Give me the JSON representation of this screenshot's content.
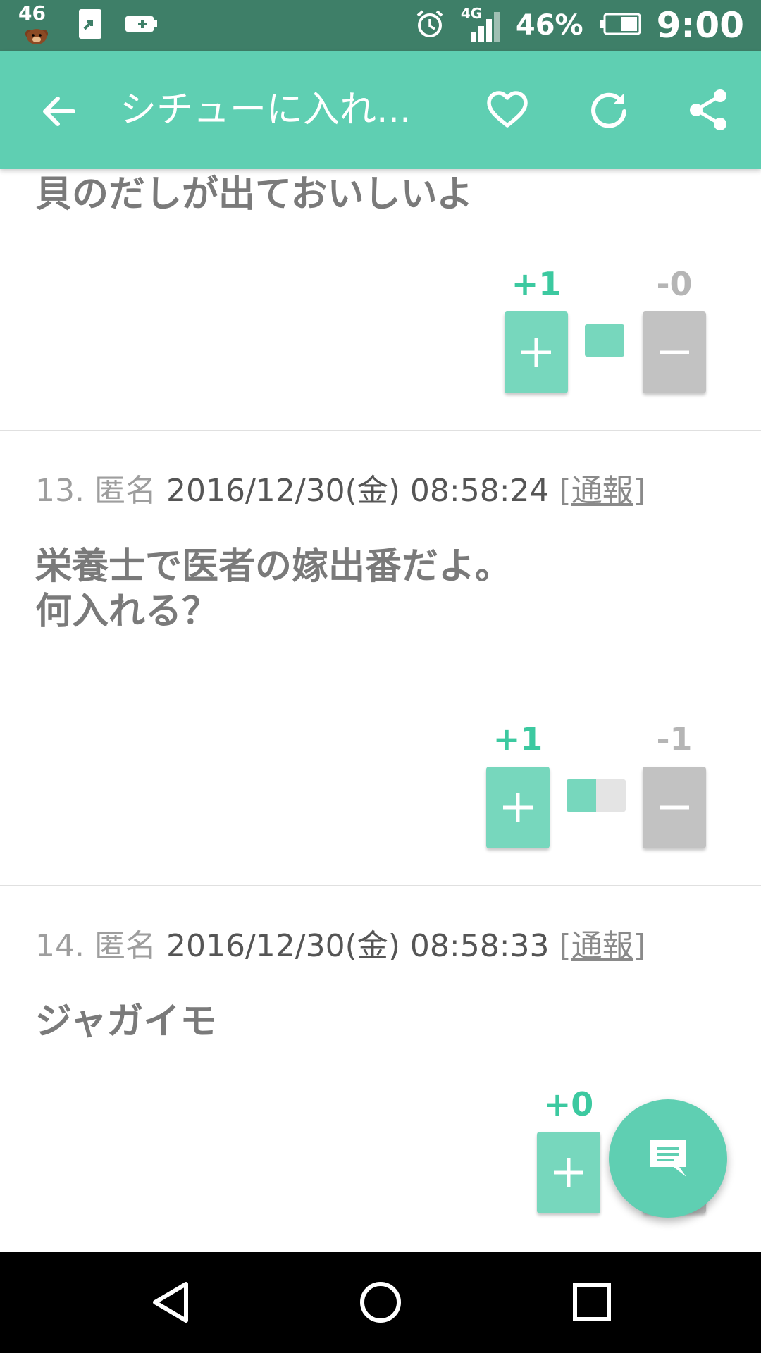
{
  "status_bar": {
    "notification_badge": "46",
    "battery_percent": "46%",
    "network": "4G",
    "time": "9:00"
  },
  "app_bar": {
    "title": "シチューに入れ..."
  },
  "posts": [
    {
      "body": "貝のだしが出ておいしいよ",
      "plus_count": "+1",
      "minus_count": "-0",
      "plus_ratio": 1.0
    },
    {
      "number": "13.",
      "author": "匿名",
      "datetime": "2016/12/30(金) 08:58:24",
      "report_label": "通報",
      "body": "栄養士で医者の嫁出番だよ。\n何入れる？",
      "plus_count": "+1",
      "minus_count": "-1",
      "plus_ratio": 0.5
    },
    {
      "number": "14.",
      "author": "匿名",
      "datetime": "2016/12/30(金) 08:58:33",
      "report_label": "通報",
      "body": "ジャガイモ",
      "plus_count": "+0",
      "minus_count": "",
      "plus_ratio": 0
    }
  ],
  "icons": {
    "back": "arrow-left-icon",
    "favorite": "heart-icon",
    "reload": "refresh-icon",
    "share": "share-icon",
    "comment": "comment-icon"
  },
  "colors": {
    "accent": "#5fcfb2",
    "status_bar": "#3e7f68",
    "plus": "#77d7bd",
    "minus": "#c2c2c2",
    "plus_text": "#3cc9a0"
  }
}
